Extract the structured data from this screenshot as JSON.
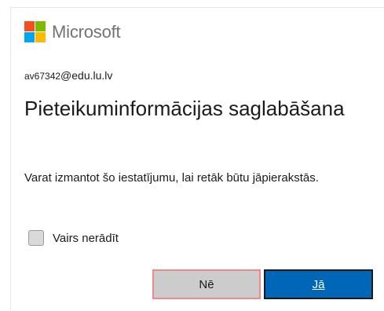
{
  "brand": {
    "name": "Microsoft",
    "logo_colors": [
      "#f25022",
      "#7fba00",
      "#00a4ef",
      "#ffb900"
    ],
    "text_color": "#737373"
  },
  "account": {
    "user": "av67342",
    "domain": "@edu.lu.lv"
  },
  "title": "Pieteikuminformācijas saglabāšana",
  "description": "Varat izmantot šo iestatījumu, lai retāk būtu jāpierakstās.",
  "checkbox": {
    "label": "Vairs nerādīt",
    "checked": false
  },
  "buttons": {
    "no_label": "Nē",
    "yes_label": "Jā"
  },
  "colors": {
    "primary_button": "#0067b8",
    "secondary_button": "#cccccc",
    "focus_outline": "#f08a8a"
  }
}
